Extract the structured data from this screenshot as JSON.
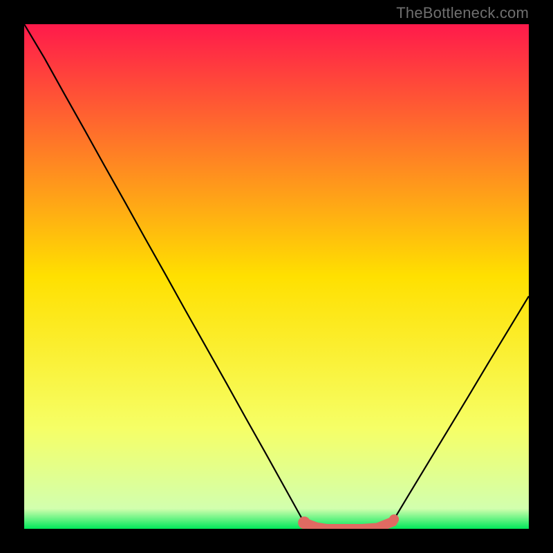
{
  "attribution": "TheBottleneck.com",
  "colors": {
    "gradient_top": "#ff1a4b",
    "gradient_mid": "#ffe000",
    "gradient_bottom": "#00e85a",
    "curve_stroke": "#000000",
    "highlight_stroke": "#e06a62",
    "frame_bg": "#000000",
    "attribution_text": "#6f6f6f"
  },
  "chart_data": {
    "type": "line",
    "title": "",
    "xlabel": "",
    "ylabel": "",
    "xlim": [
      0,
      1
    ],
    "ylim": [
      0,
      1
    ],
    "x": [
      0.0,
      0.04,
      0.08,
      0.12,
      0.16,
      0.2,
      0.24,
      0.28,
      0.32,
      0.36,
      0.4,
      0.44,
      0.48,
      0.52,
      0.555,
      0.58,
      0.6,
      0.63,
      0.67,
      0.7,
      0.73,
      0.76,
      0.8,
      0.84,
      0.88,
      0.92,
      0.96,
      1.0
    ],
    "values": [
      1.0,
      0.933,
      0.861,
      0.79,
      0.718,
      0.647,
      0.575,
      0.504,
      0.432,
      0.361,
      0.29,
      0.218,
      0.147,
      0.075,
      0.012,
      0.003,
      0.0,
      0.0,
      0.0,
      0.002,
      0.014,
      0.064,
      0.13,
      0.196,
      0.262,
      0.329,
      0.395,
      0.461
    ],
    "highlight": {
      "x_range": [
        0.555,
        0.733
      ],
      "note": "thick salmon segment marking the minimum / flat region",
      "endpoint_dot_x": 0.555
    },
    "gradient": {
      "stops": [
        {
          "pos": 0.0,
          "color": "#ff1a4b"
        },
        {
          "pos": 0.5,
          "color": "#ffe000"
        },
        {
          "pos": 0.8,
          "color": "#f6ff66"
        },
        {
          "pos": 0.96,
          "color": "#d2ffae"
        },
        {
          "pos": 1.0,
          "color": "#00e85a"
        }
      ]
    }
  }
}
